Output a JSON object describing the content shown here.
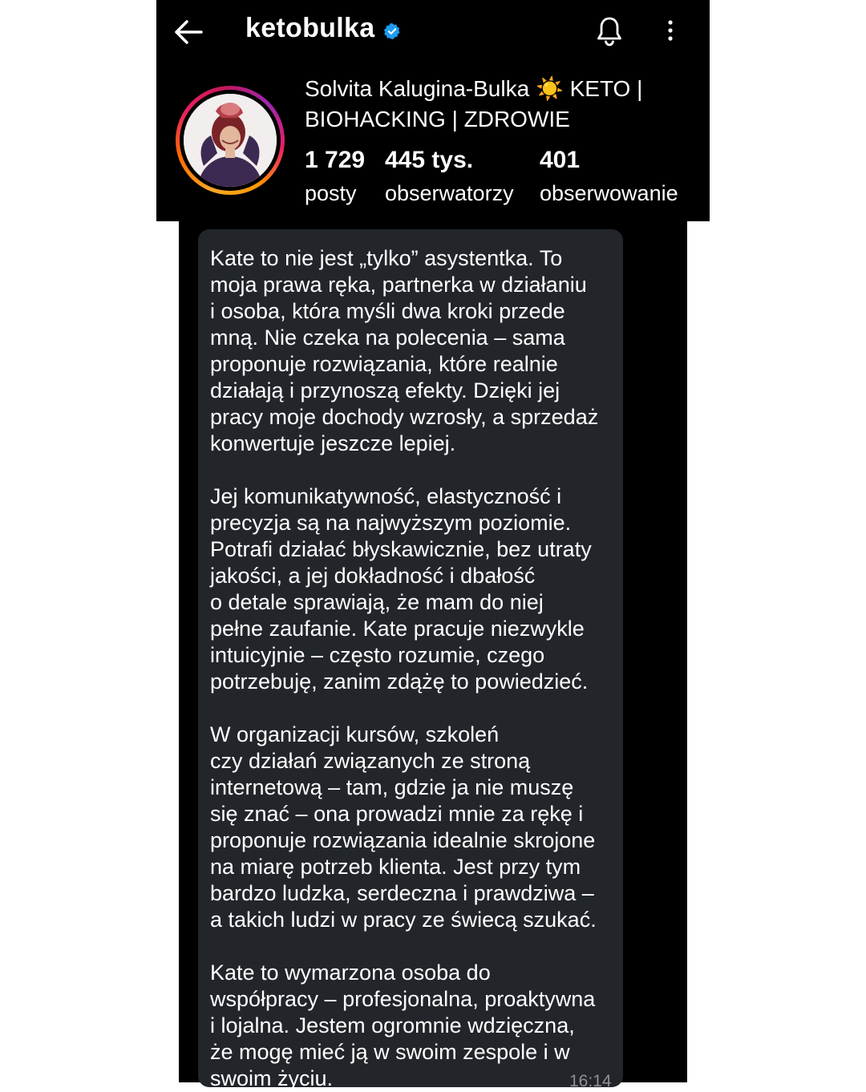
{
  "header": {
    "username": "ketobulka",
    "display_name": "Solvita Kalugina-Bulka ☀️ KETO | BIOHACKING | ZDROWIE",
    "stats": [
      {
        "value": "1 729",
        "label": "posty"
      },
      {
        "value": "445 tys.",
        "label": "obserwatorzy"
      },
      {
        "value": "401",
        "label": "obserwowanie"
      }
    ],
    "icons": [
      "back-arrow-icon",
      "verified-badge-icon",
      "bell-icon",
      "more-vertical-icon"
    ],
    "verified_color": "#1d9bf0"
  },
  "message": {
    "text": "Kate to nie jest „tylko” asystentka. To\nmoja prawa ręka, partnerka w działaniu\ni osoba, która myśli dwa kroki przede\nmną. Nie czeka na polecenia – sama\nproponuje rozwiązania, które realnie\ndziałają i przynoszą efekty. Dzięki jej\npracy moje dochody wzrosły, a sprzedaż\nkonwertuje jeszcze lepiej.\n\nJej komunikatywność, elastyczność i\nprecyzja są na najwyższym poziomie.\nPotrafi działać błyskawicznie, bez utraty\njakości, a jej dokładność i dbałość\no detale sprawiają, że mam do niej\npełne zaufanie. Kate pracuje niezwykle\nintuicyjnie – często rozumie, czego\npotrzebuję, zanim zdążę to powiedzieć.\n\nW organizacji kursów, szkoleń\nczy działań związanych ze stroną\ninternetową – tam, gdzie ja nie muszę\nsię znać – ona prowadzi mnie za rękę i\nproponuje rozwiązania idealnie skrojone\nna miarę potrzeb klienta. Jest przy tym\nbardzo ludzka, serdeczna i prawdziwa –\na takich ludzi w pracy ze świecą szukać.\n\nKate to wymarzona osoba do\nwspółpracy – profesjonalna, proaktywna\ni lojalna. Jestem ogromnie wdzięczna,\nże mogę mieć ją w swoim zespole i w\nswoim życiu.",
    "time": "16:14",
    "bubble_color": "#22262b"
  }
}
